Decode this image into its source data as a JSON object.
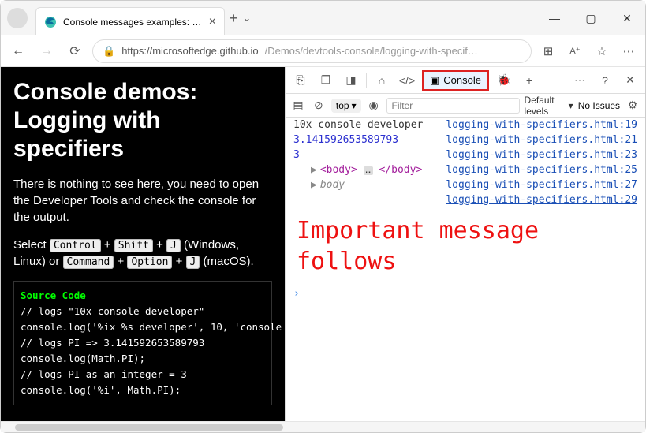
{
  "window": {
    "tab_title": "Console messages examples: Lo…"
  },
  "addressbar": {
    "host": "https://microsoftedge.github.io",
    "path": "/Demos/devtools-console/logging-with-specif…"
  },
  "page": {
    "heading": "Console demos: Logging with specifiers",
    "intro": "There is nothing to see here, you need to open the Developer Tools and check the console for the output.",
    "select_prefix": "Select ",
    "kbd_ctrl": "Control",
    "kbd_shift": "Shift",
    "kbd_j": "J",
    "windows_label": " (Windows, Linux) or ",
    "kbd_cmd": "Command",
    "kbd_opt": "Option",
    "mac_label": " (macOS).",
    "plus": " + ",
    "code_header": "Source Code",
    "code": {
      "l1": "// logs \"10x console developer\"",
      "l2": "console.log('%ix %s developer', 10, 'console",
      "l3": "// logs PI => 3.141592653589793",
      "l4": "console.log(Math.PI);",
      "l5": "// logs PI as an integer = 3",
      "l6": "console.log('%i', Math.PI);"
    }
  },
  "devtools": {
    "console_tab_label": "Console",
    "top_label": "top",
    "filter_placeholder": "Filter",
    "levels_label": "Default levels",
    "issues_label": "No Issues",
    "rows": [
      {
        "msg": "10x console developer",
        "src": "logging-with-specifiers.html:19"
      },
      {
        "msg": "3.141592653589793",
        "src": "logging-with-specifiers.html:21"
      },
      {
        "msg": "3",
        "src": "logging-with-specifiers.html:23"
      }
    ],
    "sub1_src": "logging-with-specifiers.html:25",
    "sub2_label": "body",
    "sub2_src": "logging-with-specifiers.html:27",
    "sub3_src": "logging-with-specifiers.html:29",
    "body_open": "<body>",
    "body_close": "</body>",
    "ellipsis": "…",
    "big_message": "Important message follows",
    "prompt": "›"
  }
}
